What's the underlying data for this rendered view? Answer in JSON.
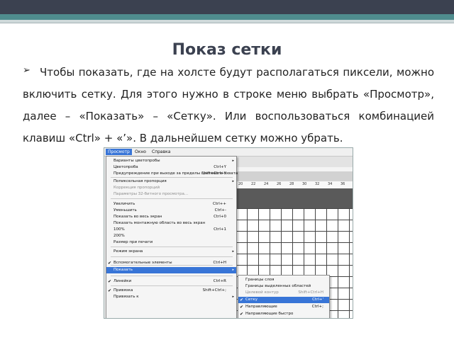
{
  "slide": {
    "title": "Показ сетки",
    "bullet": "",
    "paragraph": "Чтобы показать, где на холсте будут располагаться пиксели, можно включить сетку. Для этого нужно в строке меню выбрать «Просмотр», далее – «Показать» – «Сетку». Или воспользоваться комбинацией клавиш «Ctrl» + «’». В дальнейшем сетку можно убрать."
  },
  "screenshot": {
    "menubar": [
      "Просмотр",
      "Окно",
      "Справка"
    ],
    "ruler": [
      "20",
      "22",
      "24",
      "26",
      "28",
      "30",
      "32",
      "34",
      "36"
    ],
    "view_menu": [
      {
        "label": "Варианты цветопробы",
        "shortcut": "",
        "arrow": "▸",
        "disabled": false
      },
      {
        "label": "Цветопроба",
        "shortcut": "Ctrl+Y",
        "disabled": false
      },
      {
        "label": "Предупреждение при выходе за пределы цветового охвата",
        "shortcut": "Shift+Ctrl+Y",
        "disabled": false
      },
      {
        "label": "Попиксельная пропорция",
        "shortcut": "",
        "arrow": "▸",
        "disabled": false
      },
      {
        "label": "Коррекция пропорций",
        "shortcut": "",
        "disabled": true
      },
      {
        "label": "Параметры 32-битного просмотра...",
        "shortcut": "",
        "disabled": true
      },
      {
        "label": "Увеличить",
        "shortcut": "Ctrl++",
        "disabled": false
      },
      {
        "label": "Уменьшить",
        "shortcut": "Ctrl+-",
        "disabled": false
      },
      {
        "label": "Показать во весь экран",
        "shortcut": "Ctrl+0",
        "disabled": false
      },
      {
        "label": "Показать монтажную область во весь экран",
        "shortcut": "",
        "disabled": false
      },
      {
        "label": "100%",
        "shortcut": "Ctrl+1",
        "disabled": false
      },
      {
        "label": "200%",
        "shortcut": "",
        "disabled": false
      },
      {
        "label": "Размер при печати",
        "shortcut": "",
        "disabled": false
      },
      {
        "label": "Режим экрана",
        "shortcut": "",
        "arrow": "▸",
        "disabled": false
      },
      {
        "label": "Вспомогательные элементы",
        "shortcut": "Ctrl+H",
        "check": "✔",
        "disabled": false
      },
      {
        "label": "Показать",
        "shortcut": "",
        "arrow": "▸",
        "highlighted": true,
        "disabled": false
      },
      {
        "label": "Линейки",
        "shortcut": "Ctrl+R",
        "check": "✔",
        "disabled": false
      },
      {
        "label": "Привязка",
        "shortcut": "Shift+Ctrl+;",
        "check": "✔",
        "disabled": false
      },
      {
        "label": "Привязать к",
        "shortcut": "",
        "arrow": "▸",
        "disabled": false
      }
    ],
    "show_submenu": [
      {
        "label": "Границы слоя",
        "shortcut": "",
        "disabled": false
      },
      {
        "label": "Границы выделенных областей",
        "shortcut": "",
        "disabled": false
      },
      {
        "label": "Целевой контур",
        "shortcut": "Shift+Ctrl+H",
        "disabled": true
      },
      {
        "label": "Сетку",
        "shortcut": "Ctrl+'",
        "check": "✔",
        "highlighted": true,
        "disabled": false
      },
      {
        "label": "Направляющие",
        "shortcut": "Ctrl+;",
        "check": "✔",
        "disabled": false
      },
      {
        "label": "Направляющие быстро",
        "shortcut": "",
        "check": "✔",
        "disabled": false
      }
    ]
  }
}
